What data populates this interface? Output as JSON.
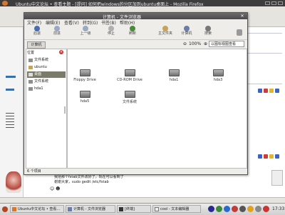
{
  "firefox": {
    "title": "Ubuntu中文论坛 • 查看主题 - [提问] 如何把windows的分区加到ubuntu桌面上 - Mozilla Firefox"
  },
  "nautilus": {
    "title": "计算机 - 文件浏览器",
    "menu": [
      "文件(F)",
      "编辑(E)",
      "查看(V)",
      "转到(G)",
      "书签(B)",
      "帮助(H)"
    ],
    "toolbar": [
      {
        "label": "后退",
        "color": "#4b6fae"
      },
      {
        "label": "前进",
        "color": "#9aa9c4"
      },
      {
        "label": "上一级",
        "color": "#9aa9c4"
      },
      {
        "label": "停止",
        "color": "#b0b0b0"
      },
      {
        "label": "刷新",
        "color": "#4b8a3a"
      },
      {
        "label": "主文件夹",
        "color": "#c6a25a"
      },
      {
        "label": "计算机",
        "color": "#6b7da6"
      },
      {
        "label": "搜索",
        "color": "#777777"
      }
    ],
    "location_button": "计算机",
    "zoom": "100%",
    "view_mode": "以图标视图查看",
    "sidebar": {
      "header": "位置",
      "items": [
        {
          "label": "文件系统",
          "selected": false
        },
        {
          "label": "ubuntu",
          "selected": false
        },
        {
          "label": "桌面",
          "selected": true
        },
        {
          "label": "文件系统",
          "selected": false
        },
        {
          "label": "hda1",
          "selected": false
        }
      ]
    },
    "drives": [
      {
        "label": "Floppy Drive"
      },
      {
        "label": "CD-ROM Drive"
      },
      {
        "label": "hda1"
      },
      {
        "label": "hda3"
      },
      {
        "label": "hda5"
      },
      {
        "label": "文件系统"
      }
    ],
    "status": "6 个项目"
  },
  "forum": {
    "chat_line_1": "我把那个fstab文件改好了，现在可以看到了",
    "chat_line_2": "谢谢大家，sudo gedit /etc/fstab",
    "emoticons": "☺ ☻"
  },
  "taskbar": {
    "tasks": [
      {
        "label": "Ubuntu中文论坛 • 查看..."
      },
      {
        "label": "计算机 - 文件浏览器"
      },
      {
        "label": "[终端]"
      },
      {
        "label": "cool - 文本编辑器"
      }
    ],
    "clock": "17:33"
  }
}
